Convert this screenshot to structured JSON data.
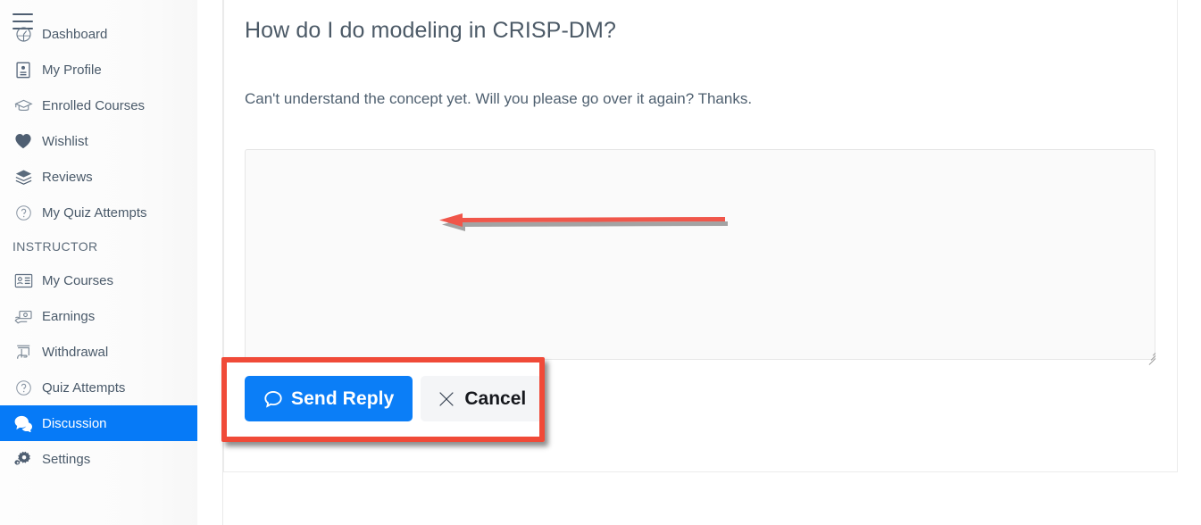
{
  "sidebar": {
    "menu_icon": "hamburger-icon",
    "items": [
      {
        "label": "Dashboard",
        "icon": "dashboard-icon",
        "active": false
      },
      {
        "label": "My Profile",
        "icon": "profile-card-icon",
        "active": false
      },
      {
        "label": "Enrolled Courses",
        "icon": "graduation-cap-icon",
        "active": false
      },
      {
        "label": "Wishlist",
        "icon": "heart-icon",
        "active": false
      },
      {
        "label": "Reviews",
        "icon": "layers-icon",
        "active": false
      },
      {
        "label": "My Quiz Attempts",
        "icon": "question-circle-icon",
        "active": false
      }
    ],
    "section_label": "INSTRUCTOR",
    "instructor_items": [
      {
        "label": "My Courses",
        "icon": "id-card-icon",
        "active": false
      },
      {
        "label": "Earnings",
        "icon": "hand-money-icon",
        "active": false
      },
      {
        "label": "Withdrawal",
        "icon": "hand-withdraw-icon",
        "active": false
      },
      {
        "label": "Quiz Attempts",
        "icon": "question-circle-icon",
        "active": false
      },
      {
        "label": "Discussion",
        "icon": "chat-bubbles-icon",
        "active": true
      },
      {
        "label": "Settings",
        "icon": "gear-icon",
        "active": false
      }
    ],
    "active_color": "#067af7"
  },
  "main": {
    "question_title": "How do I do modeling in CRISP-DM?",
    "question_body": "Can't understand the concept yet. Will you please go over it again? Thanks.",
    "reply_value": "",
    "reply_placeholder": "",
    "send_label": "Send Reply",
    "send_icon": "comment-bubble-icon",
    "send_color": "#0b7ef7",
    "cancel_label": "Cancel",
    "cancel_icon": "close-x-icon"
  },
  "annotations": {
    "highlight_color": "#f04a38",
    "arrow_color": "#f0564a",
    "arrow_direction": "left",
    "highlight_target": "send-reply-and-cancel-buttons",
    "arrow_target": "reply-textarea"
  }
}
